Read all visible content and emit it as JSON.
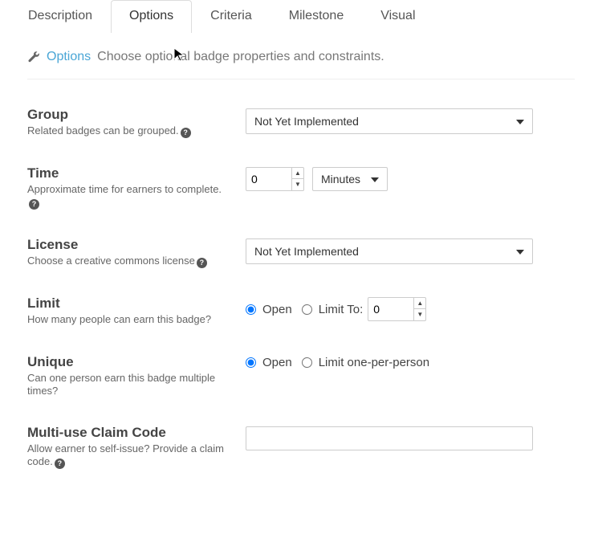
{
  "tabs": [
    {
      "label": "Description"
    },
    {
      "label": "Options"
    },
    {
      "label": "Criteria"
    },
    {
      "label": "Milestone"
    },
    {
      "label": "Visual"
    }
  ],
  "head": {
    "title": "Options",
    "subtitle": "Choose optional badge properties and constraints."
  },
  "group": {
    "name": "Group",
    "desc": "Related badges can be grouped.",
    "select_value": "Not Yet Implemented"
  },
  "time": {
    "name": "Time",
    "desc": "Approximate time for earners to complete.",
    "value": "0",
    "unit_value": "Minutes"
  },
  "license": {
    "name": "License",
    "desc": "Choose a creative commons license",
    "select_value": "Not Yet Implemented"
  },
  "limit": {
    "name": "Limit",
    "desc": "How many people can earn this badge?",
    "open_label": "Open",
    "limit_to_label": "Limit To:",
    "limit_value": "0"
  },
  "unique": {
    "name": "Unique",
    "desc": "Can one person earn this badge multiple times?",
    "open_label": "Open",
    "restrict_label": "Limit one-per-person"
  },
  "claim": {
    "name": "Multi-use Claim Code",
    "desc": "Allow earner to self-issue? Provide a claim code.",
    "value": ""
  }
}
